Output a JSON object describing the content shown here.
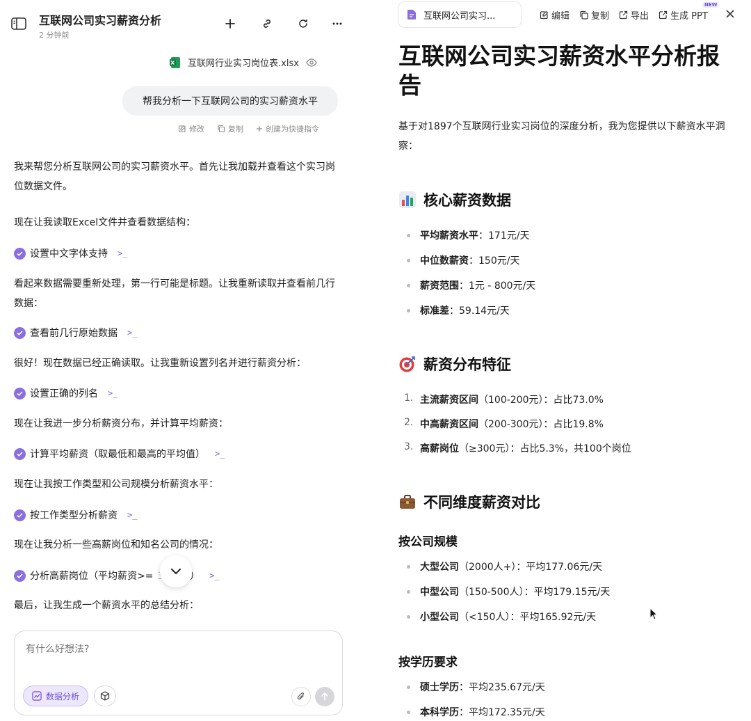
{
  "left": {
    "title": "互联网公司实习薪资分析",
    "subtitle": "2 分钟前",
    "file_name": "互联网行业实习岗位表.xlsx",
    "user_message": "帮我分析一下互联网公司的实习薪资水平",
    "actions": {
      "edit": "修改",
      "copy": "复制",
      "shortcut": "创建为快捷指令"
    },
    "paras": [
      "我来帮您分析互联网公司的实习薪资水平。首先让我加载并查看这个实习岗位数据文件。",
      "现在让我读取Excel文件并查看数据结构：",
      "看起来数据需要重新处理，第一行可能是标题。让我重新读取并查看前几行数据：",
      "很好！现在数据已经正确读取。让我重新设置列名并进行薪资分析：",
      "现在让我进一步分析薪资分布，并计算平均薪资：",
      "现在让我按工作类型和公司规模分析薪资水平：",
      "现在让我分析一些高薪岗位和知名公司的情况：",
      "最后，让我生成一个薪资水平的总结分析："
    ],
    "steps": [
      "设置中文字体支持",
      "查看前几行原始数据",
      "设置正确的列名",
      "计算平均薪资（取最低和最高的平均值）",
      "按工作类型分析薪资",
      "分析高薪岗位（平均薪资>=",
      "）"
    ],
    "step_obscured_fragment": "300元",
    "composer": {
      "placeholder": "有什么好想法?",
      "chip_label": "数据分析"
    }
  },
  "right": {
    "tab_title": "互联网公司实习...",
    "toolbar": {
      "edit": "编辑",
      "copy": "复制",
      "export": "导出",
      "ppt": "生成 PPT",
      "new_badge": "NEW"
    },
    "h1": "互联网公司实习薪资水平分析报告",
    "intro": "基于对1897个互联网行业实习岗位的深度分析，我为您提供以下薪资水平洞察：",
    "sections": {
      "core": {
        "title": "核心薪资数据",
        "items": [
          {
            "label": "平均薪资水平",
            "value": "：171元/天"
          },
          {
            "label": "中位数薪资",
            "value": "：150元/天"
          },
          {
            "label": "薪资范围",
            "value": "：1元 - 800元/天"
          },
          {
            "label": "标准差",
            "value": "：59.14元/天"
          }
        ]
      },
      "distribution": {
        "title": "薪资分布特征",
        "items": [
          {
            "num": "1.",
            "label": "主流薪资区间",
            "rest": "（100-200元）：占比73.0%"
          },
          {
            "num": "2.",
            "label": "中高薪资区间",
            "rest": "（200-300元）：占比19.8%"
          },
          {
            "num": "3.",
            "label": "高薪岗位",
            "rest": "（≥300元）：占比5.3%，共100个岗位"
          }
        ]
      },
      "compare": {
        "title": "不同维度薪资对比",
        "by_size_title": "按公司规模",
        "by_size": [
          {
            "label": "大型公司",
            "rest": "（2000人+）：平均177.06元/天"
          },
          {
            "label": "中型公司",
            "rest": "（150-500人）：平均179.15元/天"
          },
          {
            "label": "小型公司",
            "rest": "（<150人）：平均165.92元/天"
          }
        ],
        "by_edu_title": "按学历要求",
        "by_edu": [
          {
            "label": "硕士学历",
            "rest": "：平均235.67元/天"
          },
          {
            "label": "本科学历",
            "rest": "：平均172.35元/天"
          }
        ]
      }
    }
  },
  "colors": {
    "accent": "#8b6fe0",
    "check": "#8b6fe0",
    "bubble": "#f1f2f4"
  }
}
